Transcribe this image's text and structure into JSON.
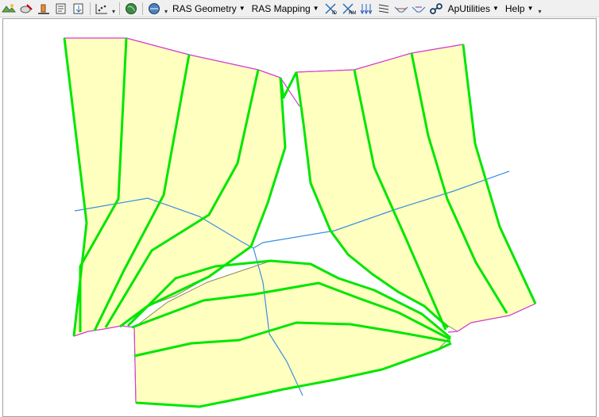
{
  "toolbar": {
    "icons": [
      "rasmapper-layers-icon",
      "edit-features-icon",
      "terrain-icon",
      "open-file-icon",
      "export-icon",
      "data-points-icon",
      "georef-icon",
      "globe-icon"
    ],
    "menus": [
      {
        "label": "RAS Geometry"
      },
      {
        "label": "RAS Mapping"
      },
      {
        "label": "ApUtilities"
      },
      {
        "label": "Help"
      }
    ],
    "ras_tool_icons": [
      "xs-id-icon",
      "river-reach-icon",
      "flow-arrows-icon",
      "bank-lines-icon",
      "levee-icon",
      "ineffective-flow-icon",
      "link-icon"
    ],
    "ras_tool_labels": {
      "id": "ID",
      "rm": "RM"
    }
  },
  "colors": {
    "polygon_fill": "#ffffc0",
    "cross_section": "#00e600",
    "river": "#3a8fe0",
    "boundary": "#d83ad8",
    "polygon_edge": "#8a8a50"
  }
}
